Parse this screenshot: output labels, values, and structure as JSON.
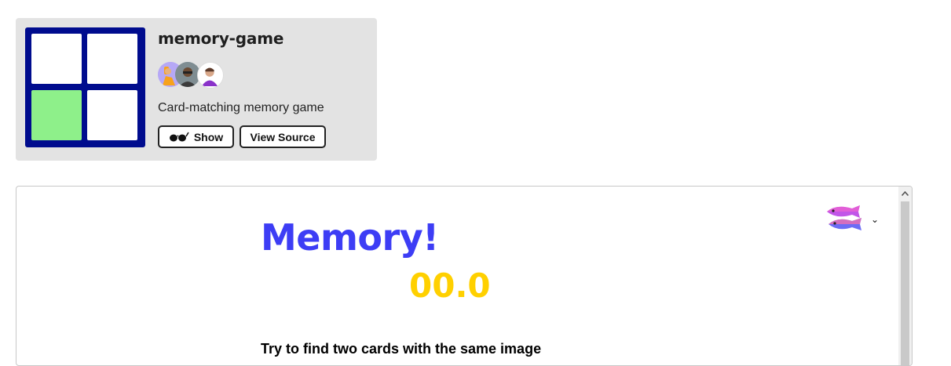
{
  "project": {
    "title": "memory-game",
    "description": "Card-matching memory game",
    "buttons": {
      "show_label": "Show",
      "source_label": "View Source"
    },
    "thumbnail": {
      "background_color": "#000c8e",
      "highlight_tile_color": "#8ef08a"
    },
    "avatars": [
      "avatar",
      "avatar",
      "avatar"
    ]
  },
  "embed": {
    "menu_icon": "glitch-fish-icon",
    "title": "Memory!",
    "timer": "00.0",
    "instructions": "Try to find two cards with the same image",
    "colors": {
      "title": "#3d3df5",
      "timer": "#ffd000"
    }
  }
}
